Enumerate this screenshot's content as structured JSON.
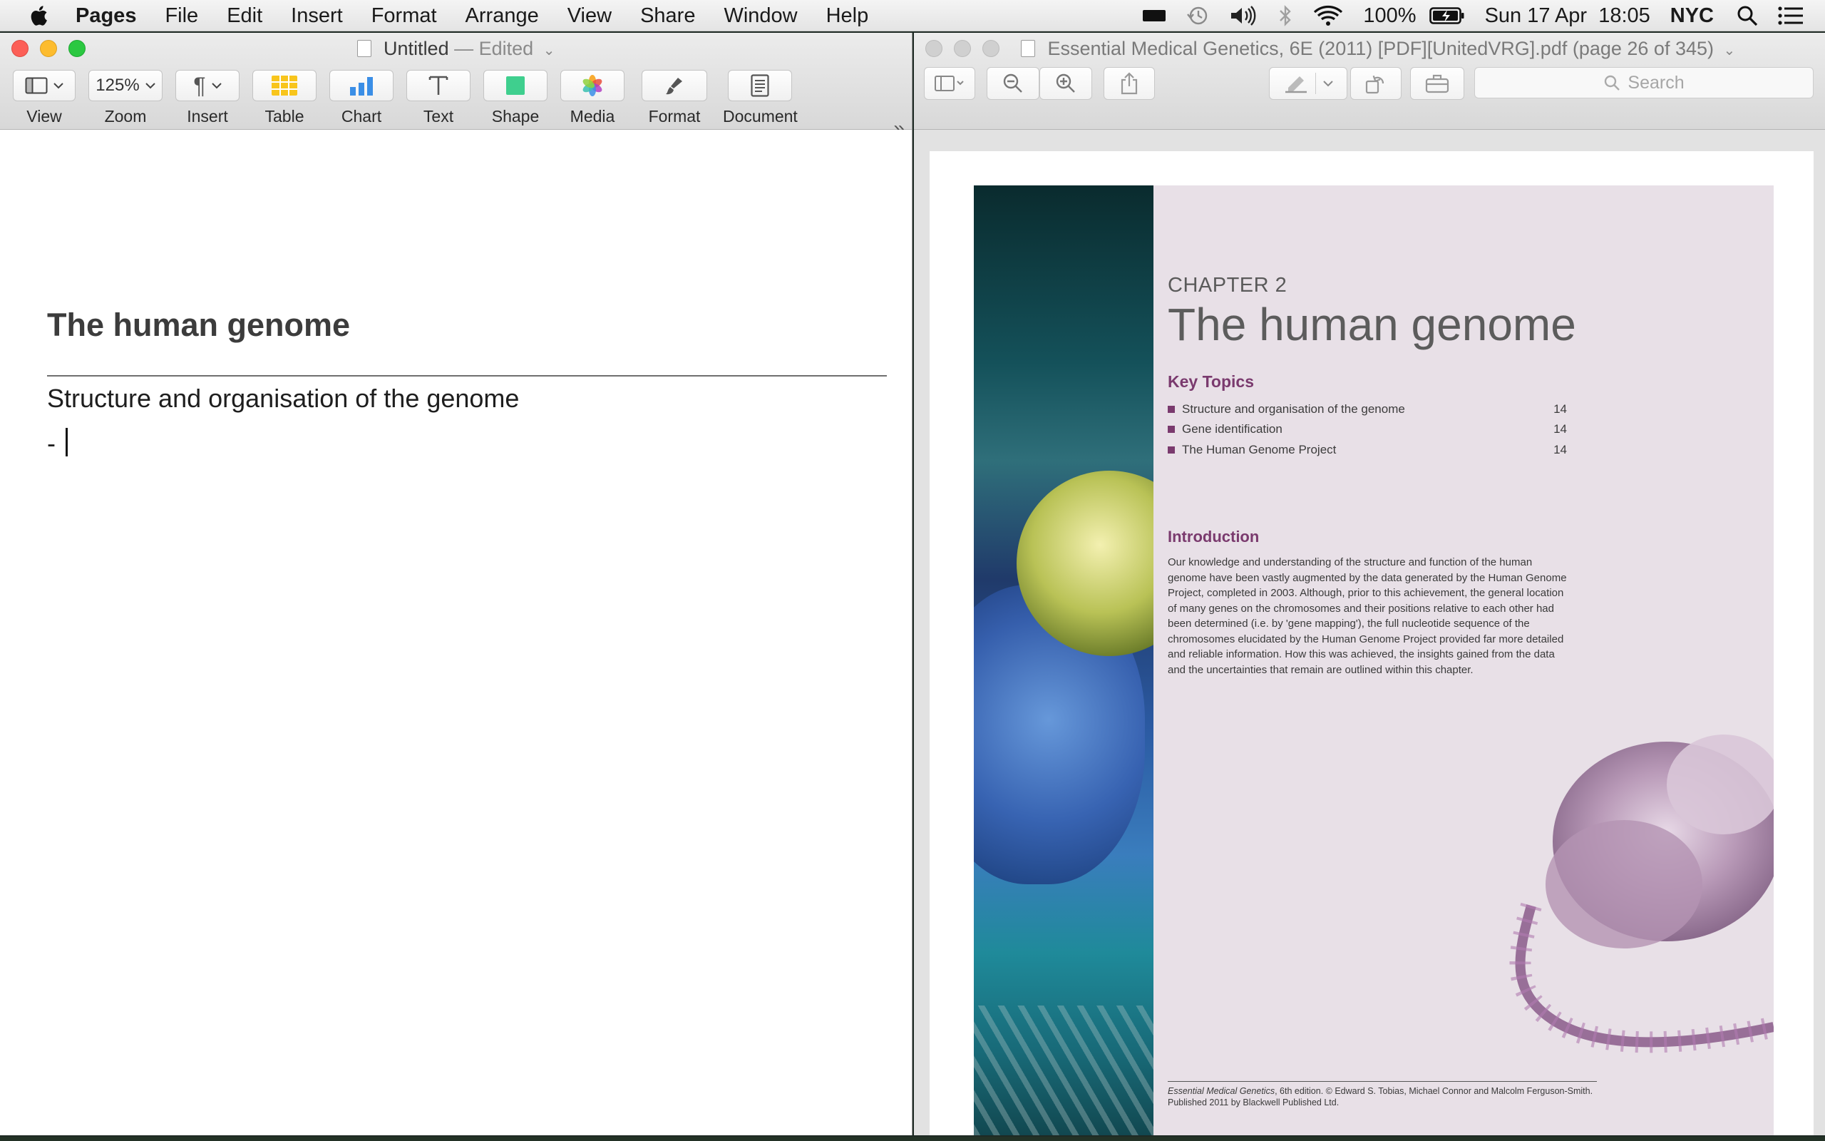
{
  "menubar": {
    "app_name": "Pages",
    "items": [
      "File",
      "Edit",
      "Insert",
      "Format",
      "Arrange",
      "View",
      "Share",
      "Window",
      "Help"
    ],
    "battery": "100%",
    "datetime": "Sun 17 Apr  18:05",
    "location": "NYC"
  },
  "pages_window": {
    "title": "Untitled",
    "title_status": "— Edited",
    "toolbar": {
      "view": "View",
      "zoom_value": "125%",
      "zoom": "Zoom",
      "insert": "Insert",
      "table": "Table",
      "chart": "Chart",
      "text": "Text",
      "shape": "Shape",
      "media": "Media",
      "format": "Format",
      "document": "Document"
    },
    "document": {
      "heading": "The human genome",
      "subheading": "Structure and organisation of the genome",
      "bullet": "-"
    }
  },
  "preview_window": {
    "title": "Essential Medical Genetics, 6E (2011) [PDF][UnitedVRG].pdf (page 26 of 345)",
    "search_placeholder": "Search",
    "page": {
      "chapter": "CHAPTER 2",
      "title": "The human genome",
      "key_topics_heading": "Key Topics",
      "topics": [
        {
          "label": "Structure and organisation of the genome",
          "page": "14"
        },
        {
          "label": "Gene identification",
          "page": "14"
        },
        {
          "label": "The Human Genome Project",
          "page": "14"
        }
      ],
      "intro_heading": "Introduction",
      "intro_text": "Our knowledge and understanding of the structure and function of the human genome have been vastly augmented by the data generated by the Human Genome Project, completed in 2003. Although, prior to this achievement, the general location of many genes on the chromosomes and their positions relative to each other had been determined (i.e. by 'gene mapping'), the full nucleotide sequence of the chromosomes elucidated by the Human Genome Project provided far more detailed and reliable information. How this was achieved, the insights gained from the data and the uncertainties that remain are outlined within this chapter.",
      "footer_book": "Essential Medical Genetics",
      "footer_rest": ", 6th edition. © Edward S. Tobias, Michael Connor and Malcolm Ferguson-Smith. Published 2011 by Blackwell Published Ltd."
    }
  }
}
